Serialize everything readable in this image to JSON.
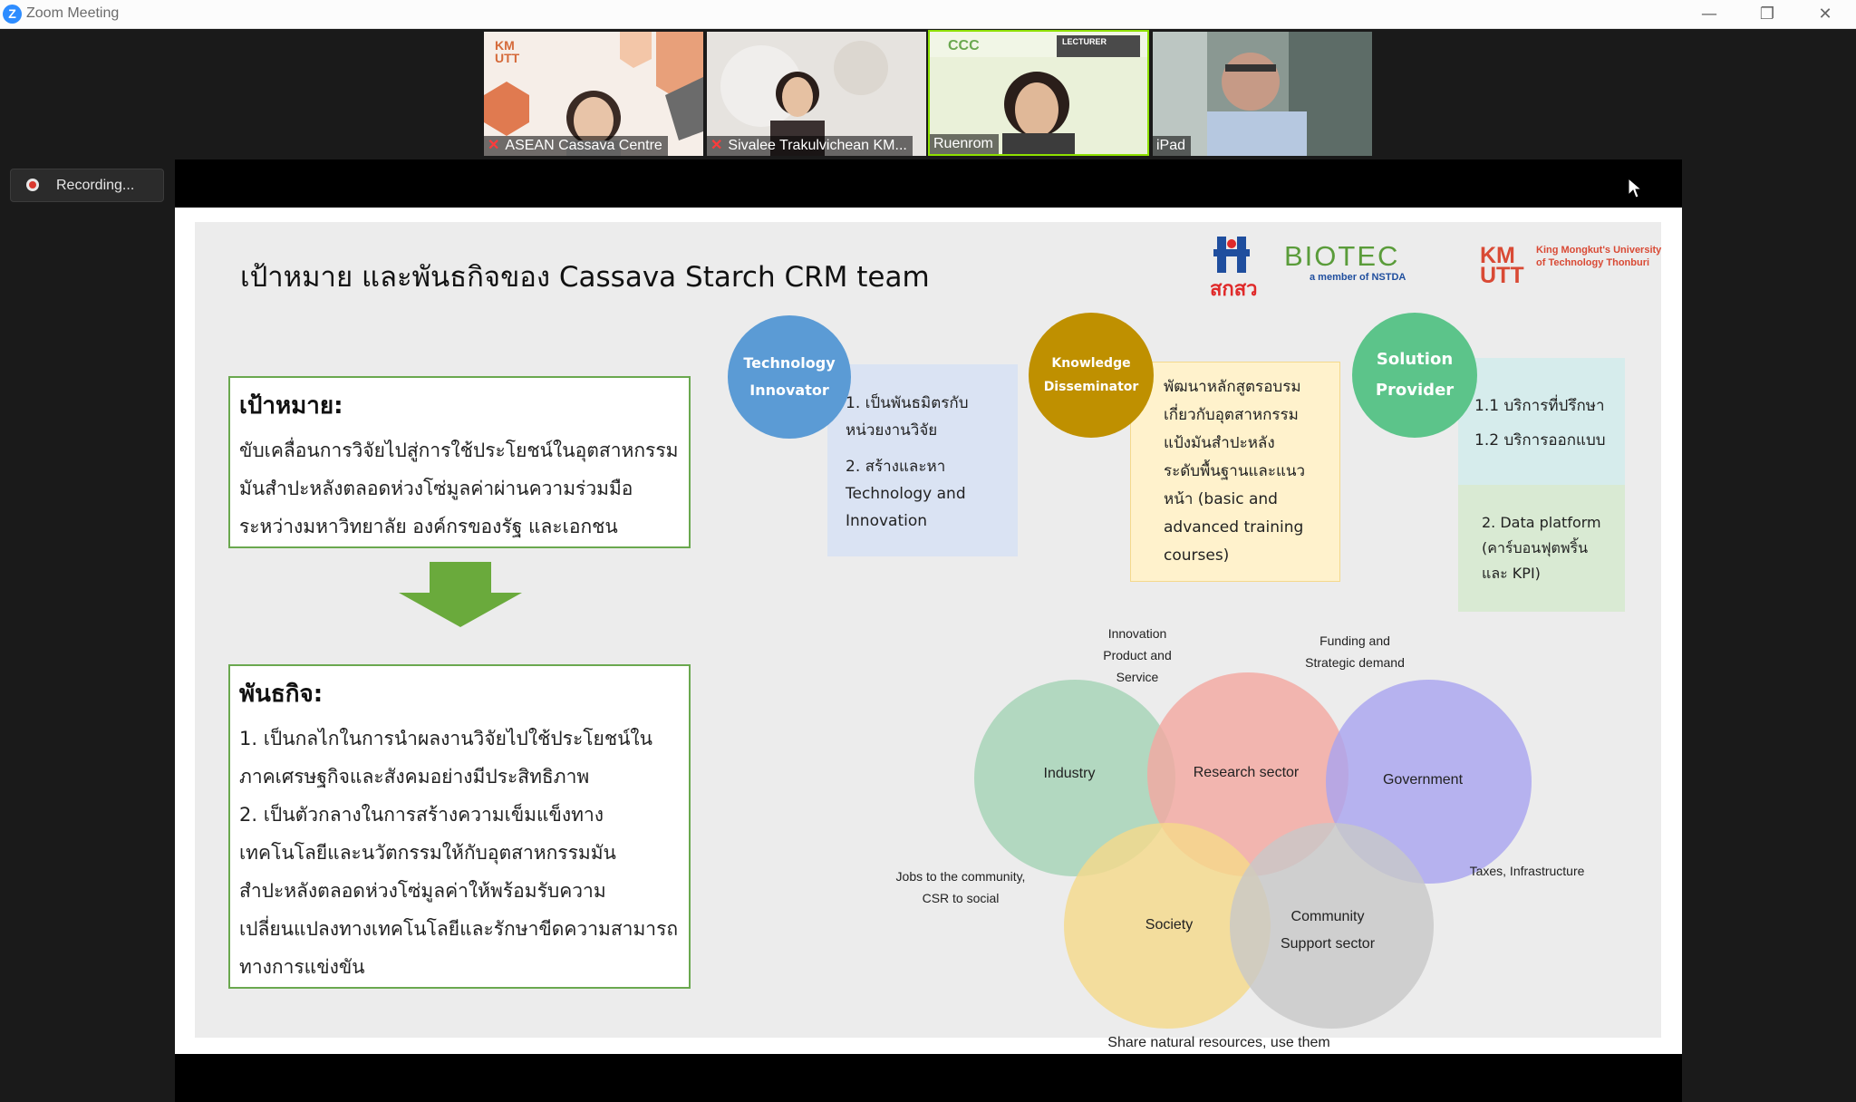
{
  "window": {
    "title": "Zoom Meeting",
    "minimize": "—",
    "restore": "❐",
    "close": "✕"
  },
  "participants": [
    {
      "name": "ASEAN Cassava Centre",
      "muted": true
    },
    {
      "name": "Sivalee Trakulvichean KM...",
      "muted": true
    },
    {
      "name": "Ruenrom",
      "muted": false,
      "active": true
    },
    {
      "name": "iPad",
      "muted": false
    }
  ],
  "thumb_text": {
    "kmutt_small": "KM\nUTT",
    "lecturer_badge": "LECTURER"
  },
  "recording": {
    "label": "Recording..."
  },
  "slide": {
    "title": "เป้าหมาย และพันธกิจของ Cassava Starch CRM team",
    "logos": {
      "tsao_text": "สกสว",
      "biotec": "BIOTEC",
      "biotec_sub": "a member of NSTDA",
      "kmutt_mark": "KM UTT",
      "kmutt_name": "King Mongkut's University of Technology Thonburi"
    },
    "goal": {
      "heading": "เป้าหมาย:",
      "text": "ขับเคลื่อนการวิจัยไปสู่การใช้ประโยชน์ในอุตสาหกรรมมันสำปะหลังตลอดห่วงโซ่มูลค่าผ่านความร่วมมือระหว่างมหาวิทยาลัย องค์กรของรัฐ และเอกชน"
    },
    "mission": {
      "heading": "พันธกิจ:",
      "item1": "1. เป็นกลไกในการนำผลงานวิจัยไปใช้ประโยชน์ในภาคเศรษฐกิจและสังคมอย่างมีประสิทธิภาพ",
      "item2": "2. เป็นตัวกลางในการสร้างความเข็มแข็งทางเทคโนโลยีและนวัตกรรมให้กับอุตสาหกรรมมันสำปะหลังตลอดห่วงโซ่มูลค่าให้พร้อมรับความเปลี่ยนแปลงทางเทคโนโลยีและรักษาขีดความสามารถทางการแข่งขัน"
    },
    "roles": [
      {
        "title": "Technology Innovator",
        "color": "#5b9bd5",
        "box_color": "#dae3f3",
        "items": [
          "1. เป็นพันธมิตรกับหน่วยงานวิจัย",
          "2. สร้างและหา Technology and Innovation"
        ]
      },
      {
        "title": "Knowledge Disseminator",
        "color": "#bf9000",
        "box_color": "#fff2cc",
        "items": [
          "พัฒนาหลักสูตรอบรมเกี่ยวกับอุตสาหกรรมแป้งมันสำปะหลังระดับพื้นฐานและแนวหน้า (basic and advanced training courses)"
        ]
      },
      {
        "title": "Solution Provider",
        "color": "#5cc48a",
        "box_color_top": "#d6ecec",
        "box_color_bottom": "#d9ead3",
        "items_top": [
          "1.1 บริการที่ปรึกษา",
          "1.2 บริการออกแบบ"
        ],
        "items_bottom": [
          "2. Data platform (คาร์บอนฟุตพริ้นและ KPI)"
        ]
      }
    ],
    "venn": {
      "circles": [
        {
          "label": "Industry",
          "color": "#a8d5b9"
        },
        {
          "label": "Research sector",
          "color": "#f4a8a0"
        },
        {
          "label": "Government",
          "color": "#a9a4f0"
        },
        {
          "label": "Society",
          "color": "#f5d98a"
        },
        {
          "label": "Community Support sector",
          "color": "#c8c8c8"
        }
      ],
      "notes": {
        "innovation": "Innovation Product and Service",
        "funding": "Funding and Strategic demand",
        "jobs": "Jobs to the community, CSR to social",
        "taxes": "Taxes, Infrastructure",
        "share": "Share natural resources, use them"
      }
    }
  }
}
